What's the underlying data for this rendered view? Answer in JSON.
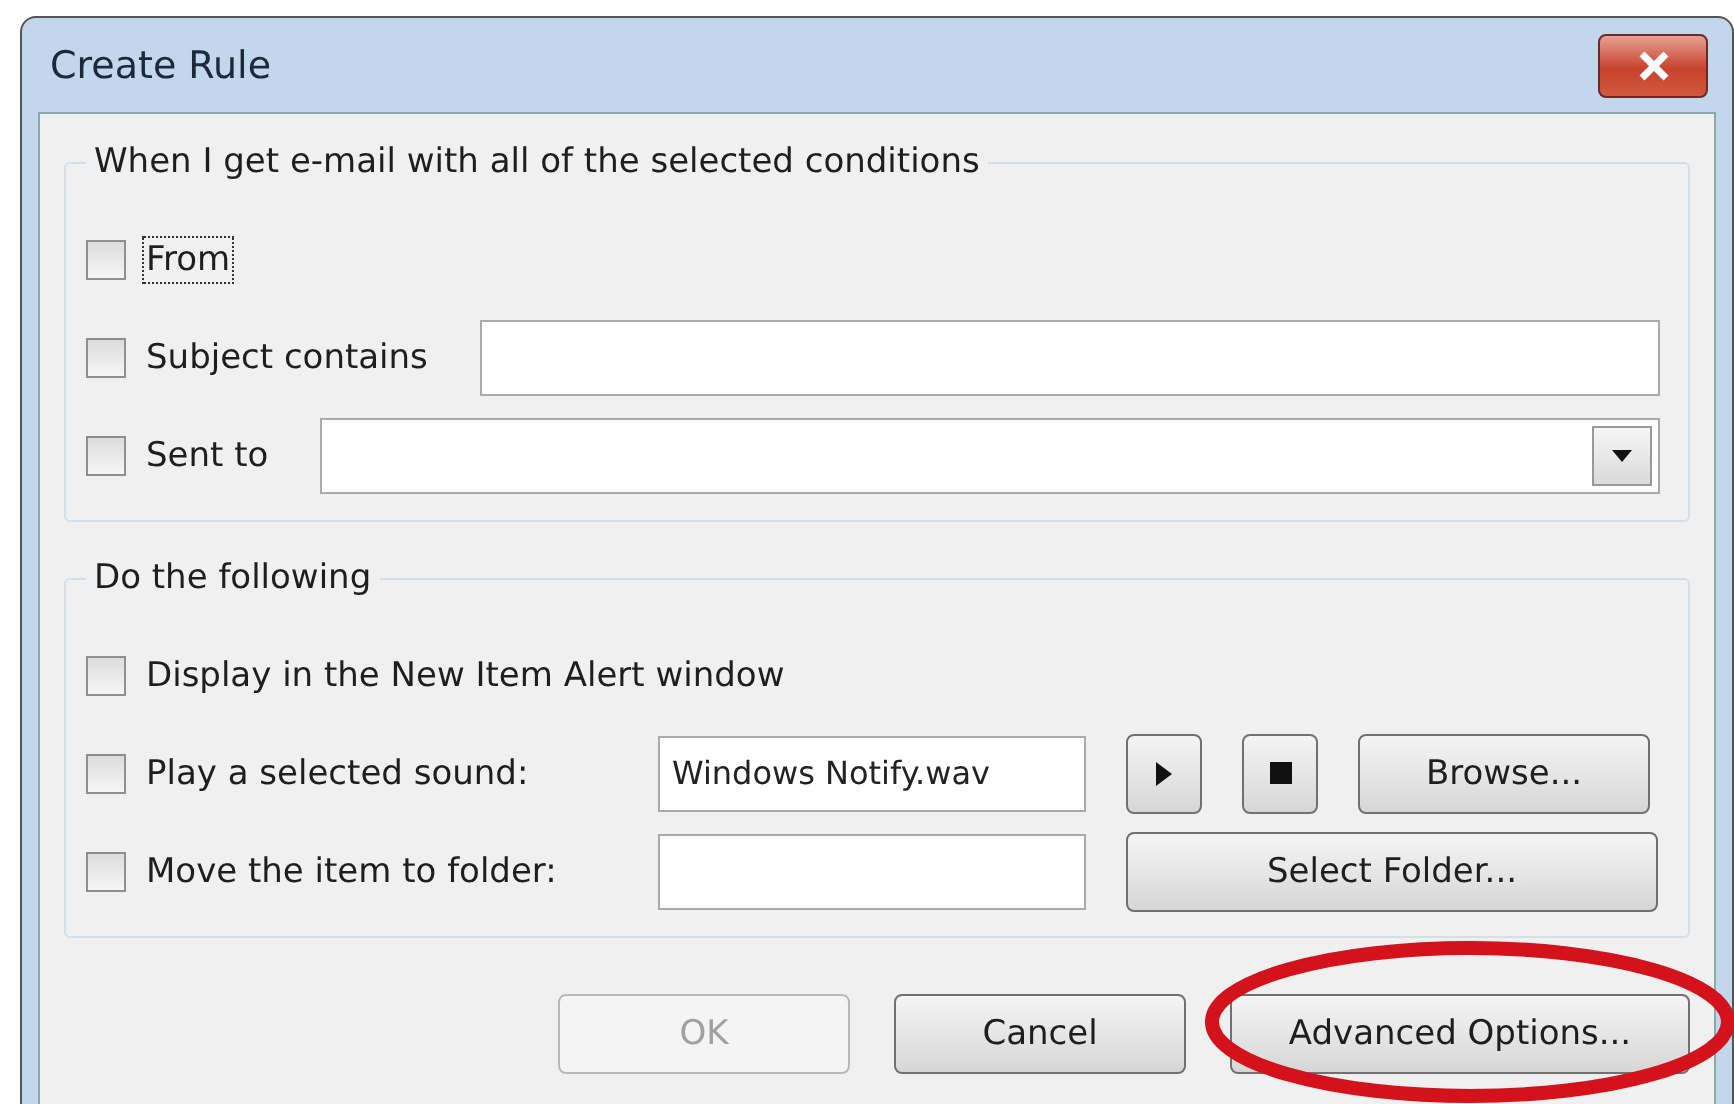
{
  "window": {
    "title": "Create Rule"
  },
  "conditions": {
    "heading": "When I get e-mail with all of the selected conditions",
    "rows": [
      {
        "kind": "plain",
        "label": "From",
        "checked": false,
        "focused": true
      },
      {
        "kind": "text",
        "label": "Subject contains",
        "checked": false,
        "focused": false
      },
      {
        "kind": "combo",
        "label": "Sent to",
        "checked": false,
        "focused": false
      }
    ]
  },
  "actions": {
    "heading": "Do the following",
    "rows": [
      {
        "kind": "plain",
        "label": "Display in the New Item Alert window",
        "checked": false,
        "focused": false
      },
      {
        "kind": "sound",
        "label": "Play a selected sound:",
        "checked": false,
        "focused": false,
        "value": "Windows Notify.wav",
        "button": "Browse..."
      },
      {
        "kind": "folder",
        "label": "Move the item to folder:",
        "checked": false,
        "focused": false,
        "button": "Select Folder..."
      }
    ]
  },
  "buttons": [
    {
      "label": "OK",
      "disabled": true
    },
    {
      "label": "Cancel",
      "disabled": false
    },
    {
      "label": "Advanced Options...",
      "disabled": false
    }
  ],
  "annotation": {
    "kind": "ellipse"
  }
}
